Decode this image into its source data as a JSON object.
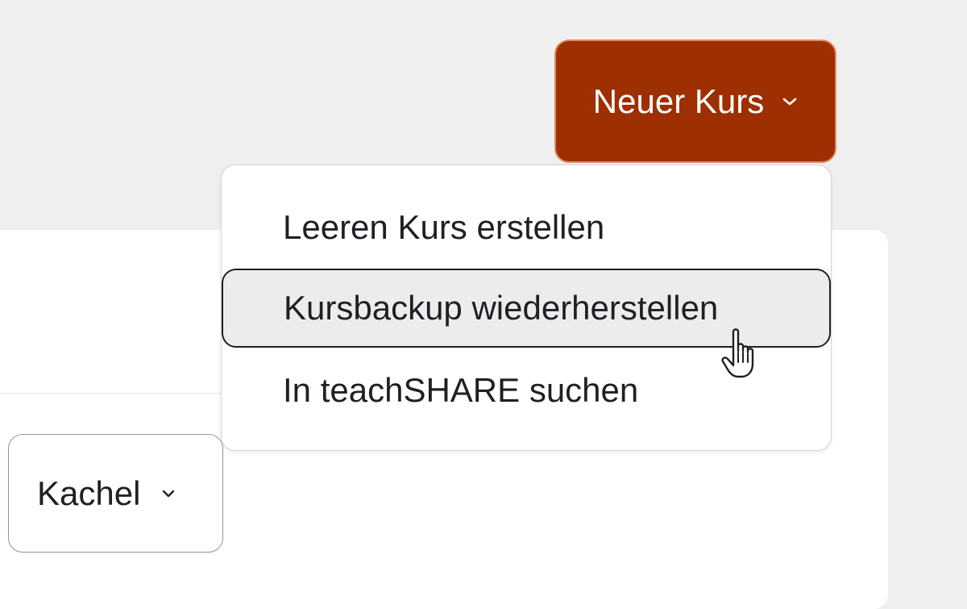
{
  "header": {
    "new_course_button": {
      "label": "Neuer Kurs",
      "icon": "chevron-down-icon",
      "color": "#9e2f00"
    }
  },
  "new_course_menu": {
    "items": [
      {
        "label": "Leeren Kurs erstellen"
      },
      {
        "label": "Kursbackup wiederherstellen",
        "hovered": true
      },
      {
        "label": "In teachSHARE suchen"
      }
    ]
  },
  "view_selector": {
    "selected": "Kachel",
    "icon": "chevron-down-icon"
  },
  "cursor": {
    "icon": "hand-pointer-icon"
  }
}
